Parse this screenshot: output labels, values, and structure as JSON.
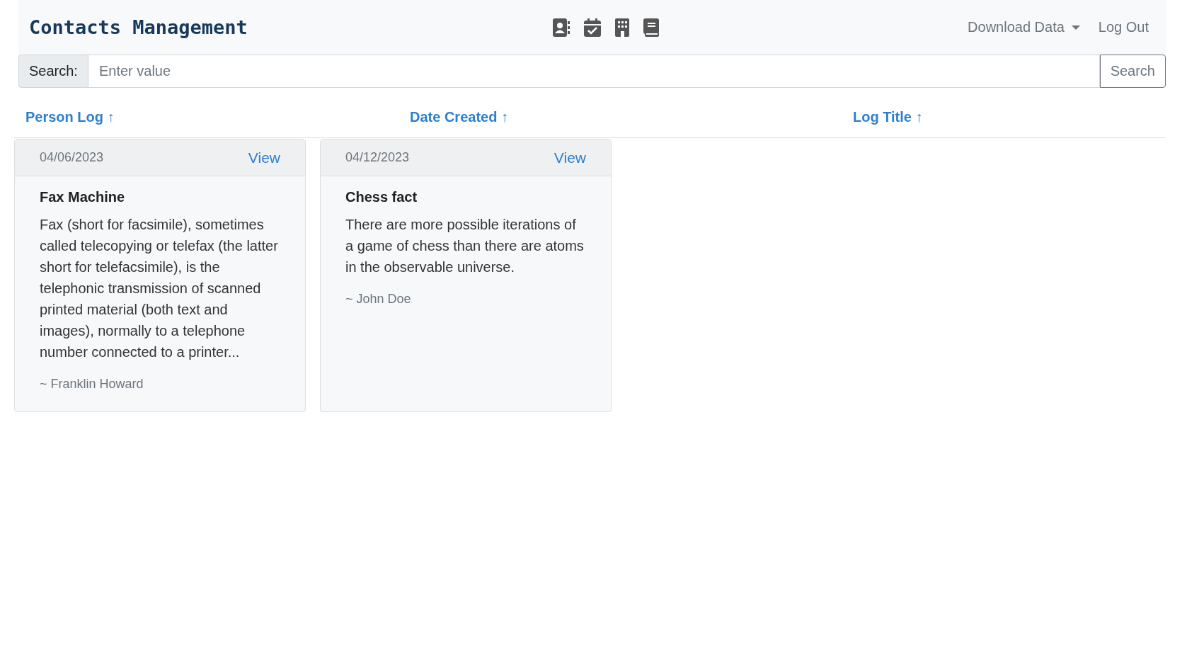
{
  "header": {
    "title": "Contacts Management",
    "menu": [
      {
        "label": "Download Data",
        "kind": "dropdown"
      },
      {
        "label": "Log Out",
        "kind": "link"
      }
    ]
  },
  "search": {
    "label": "Search:",
    "placeholder": "Enter value",
    "button": "Search"
  },
  "sort_headers": [
    "Person Log ↑",
    "Date Created ↑",
    "Log Title ↑"
  ],
  "cards": [
    {
      "date": "04/06/2023",
      "action": "View",
      "title": "Fax Machine",
      "body": "Fax (short for facsimile), sometimes called telecopying or telefax (the latter short for telefacsimile), is the telephonic transmission of scanned printed material (both text and images), normally to a telephone number connected to a printer...",
      "author": "~ Franklin Howard"
    },
    {
      "date": "04/12/2023",
      "action": "View",
      "title": "Chess fact",
      "body": "There are more possible iterations of a game of chess than there are atoms in the observable universe.",
      "author": "~ John Doe"
    }
  ]
}
